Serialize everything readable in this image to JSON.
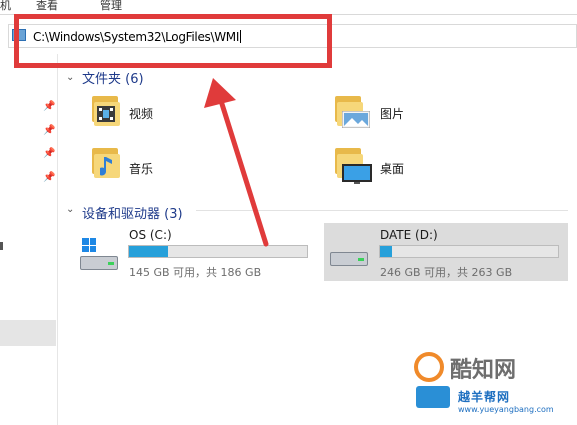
{
  "ribbon": {
    "tabs": [
      "机",
      "查看",
      "管理"
    ]
  },
  "address_bar": {
    "path": "C:\\Windows\\System32\\LogFiles\\WMI"
  },
  "folders_section": {
    "heading": "文件夹 (6)",
    "items": [
      {
        "label": "视频",
        "icon": "video-folder-icon"
      },
      {
        "label": "图片",
        "icon": "pictures-folder-icon"
      },
      {
        "label": "音乐",
        "icon": "music-folder-icon"
      },
      {
        "label": "桌面",
        "icon": "desktop-folder-icon"
      }
    ]
  },
  "devices_section": {
    "heading": "设备和驱动器 (3)",
    "drives": [
      {
        "name": "OS (C:)",
        "free_text": "145 GB 可用，共 186 GB",
        "used_fraction": 0.22
      },
      {
        "name": "DATE (D:)",
        "free_text": "246 GB 可用，共 263 GB",
        "used_fraction": 0.065
      }
    ]
  },
  "annotation": {
    "highlight_color": "#e03b3b"
  },
  "watermark": {
    "brand": "酷知网",
    "sub_brand": "越羊帮网",
    "url": "www.yueyangbang.com"
  }
}
